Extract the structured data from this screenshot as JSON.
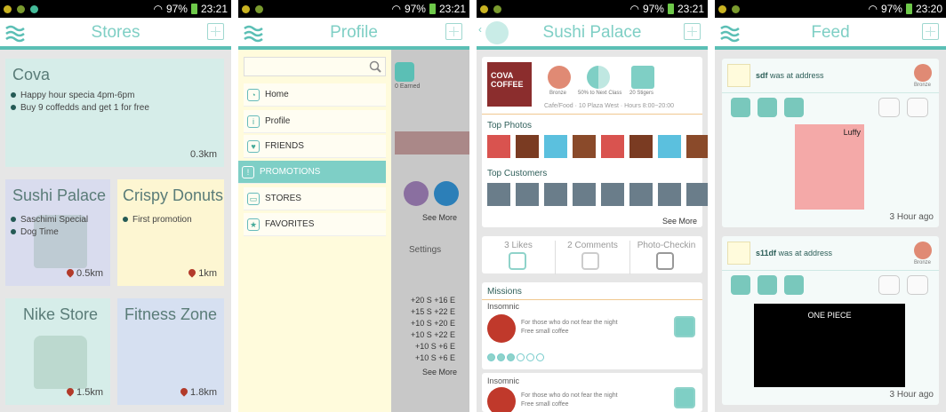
{
  "status": {
    "battery": "97%",
    "times": [
      "23:21",
      "23:21",
      "23:21",
      "23:20"
    ]
  },
  "stores": {
    "title": "Stores",
    "cards": [
      {
        "name": "Cova",
        "lines": [
          "Happy hour specia 4pm-6pm",
          "Buy 9 coffedds and get 1 for free"
        ],
        "dist": "0.3km",
        "color": "#d6ede9"
      },
      {
        "name": "Sushi Palace",
        "lines": [
          "Saschimi Special",
          "Dog Time"
        ],
        "dist": "0.5km",
        "color": "#d9dcee"
      },
      {
        "name": "Crispy Donuts",
        "lines": [
          "First promotion"
        ],
        "dist": "1km",
        "color": "#fdf6d2"
      },
      {
        "name": "Nike Store",
        "lines": [],
        "dist": "1.5km",
        "color": "#d6ede9"
      },
      {
        "name": "Fitness Zone",
        "lines": [],
        "dist": "1.8km",
        "color": "#d6e0f1"
      }
    ]
  },
  "profile": {
    "title": "Profile",
    "menu": [
      "Home",
      "Profile",
      "FRIENDS",
      "PROMOTIONS",
      "STORES",
      "FAVORITES"
    ],
    "bg": {
      "earned": "0 Earned",
      "see_more": "See More",
      "settings": "Settings",
      "coords": [
        "+20 S +16 E",
        "+15 S +22 E",
        "+10 S +20 E",
        "+10 S +22 E",
        "+10 S +6 E",
        "+10 S +6 E"
      ]
    }
  },
  "sushi": {
    "title": "Sushi Palace",
    "logo": "COVA COFFEE",
    "badges": [
      "Bronze",
      "50% to Next Class",
      "20 Stigers"
    ],
    "meta": [
      "Cafe/Food",
      "10 Plaza West",
      "Hours 8:00~20:00"
    ],
    "top_photos": "Top Photos",
    "top_customers": "Top Customers",
    "see_more": "See More",
    "stats": [
      "3 Likes",
      "2 Comments",
      "Photo-Checkin"
    ],
    "missions": "Missions",
    "mission_items": [
      {
        "title": "Insomnic",
        "desc": [
          "For those who do not fear the night",
          "Free small coffee"
        ]
      },
      {
        "title": "Insomnic",
        "desc": [
          "For those who do not fear the night",
          "Free small coffee"
        ]
      }
    ]
  },
  "feed": {
    "title": "Feed",
    "posts": [
      {
        "user": "sdf",
        "action": "was at address",
        "badge": "Bronze",
        "time": "3 Hour ago",
        "img": "Luffy"
      },
      {
        "user": "s11df",
        "action": "was at address",
        "badge": "Bronze",
        "time": "3 Hour ago",
        "img": "ONE PIECE"
      }
    ]
  },
  "colors": {
    "accent": "#5bbfb5",
    "title": "#7fcfc5"
  }
}
